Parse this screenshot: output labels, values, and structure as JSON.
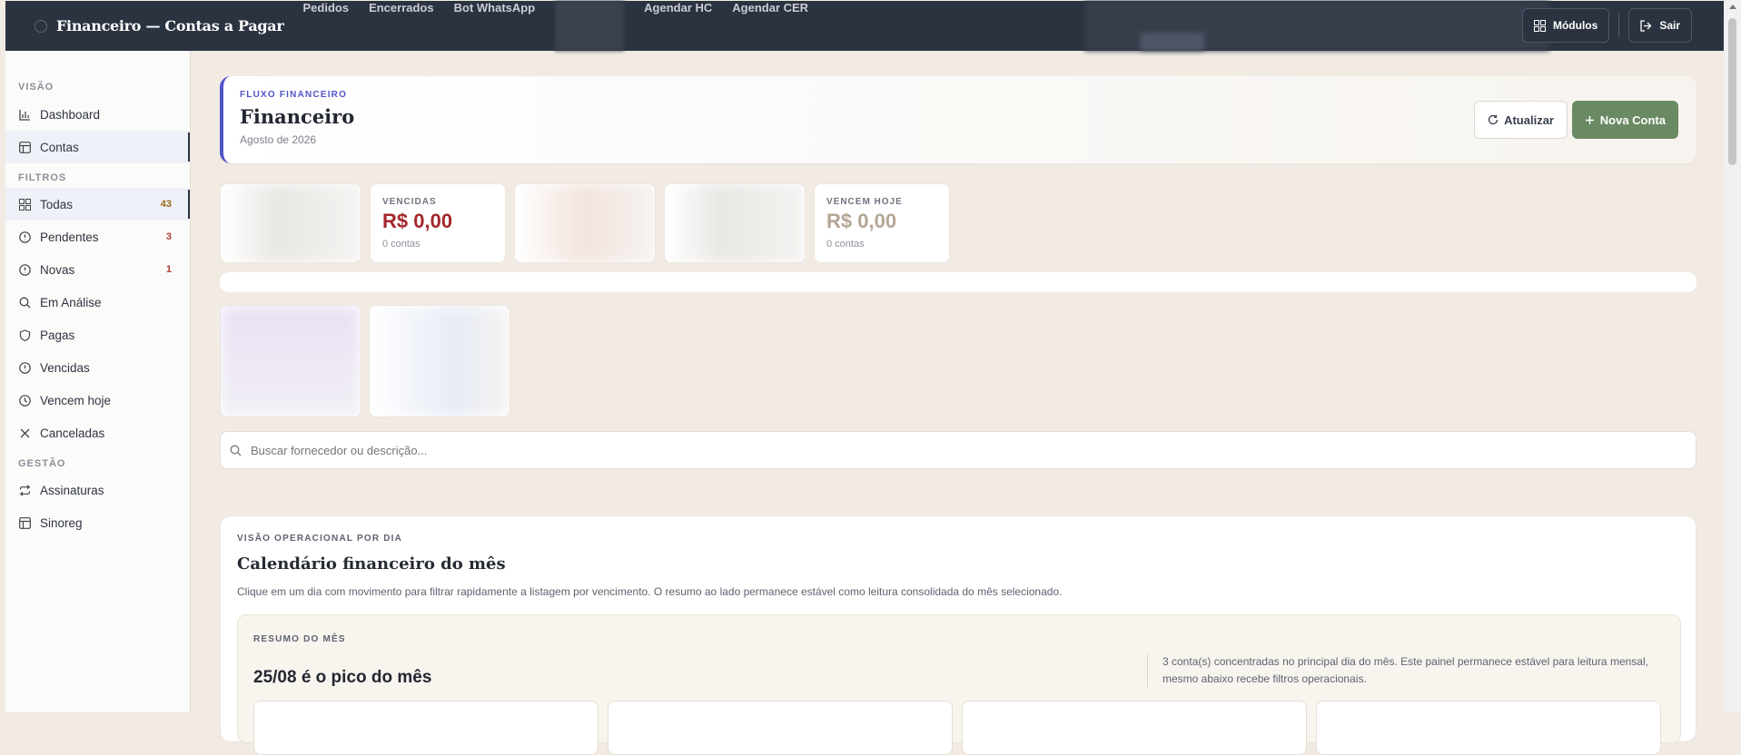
{
  "topbar": {
    "title": "Financeiro — Contas a Pagar",
    "nav": [
      "Pedidos",
      "Encerrados",
      "Bot WhatsApp",
      "",
      "Agendar HC",
      "Agendar CER"
    ],
    "modules_label": "Módulos",
    "logout_label": "Sair"
  },
  "sidebar": {
    "sections": {
      "visao": "VISÃO",
      "filtros": "FILTROS",
      "gestao": "GESTÃO"
    },
    "visao_items": [
      {
        "label": "Dashboard",
        "icon": "bar-chart-icon"
      },
      {
        "label": "Contas",
        "icon": "table-icon"
      }
    ],
    "filtro_items": [
      {
        "label": "Todas",
        "icon": "grid-icon",
        "badge": "43"
      },
      {
        "label": "Pendentes",
        "icon": "alert-circle-icon",
        "badge": "3"
      },
      {
        "label": "Novas",
        "icon": "alert-circle-icon",
        "badge": "1"
      },
      {
        "label": "Em Análise",
        "icon": "search-icon"
      },
      {
        "label": "Pagas",
        "icon": "shield-icon"
      },
      {
        "label": "Vencidas",
        "icon": "alert-circle-icon"
      },
      {
        "label": "Vencem hoje",
        "icon": "clock-icon"
      },
      {
        "label": "Canceladas",
        "icon": "close-icon"
      }
    ],
    "gestao_items": [
      {
        "label": "Assinaturas",
        "icon": "repeat-icon"
      },
      {
        "label": "Sinoreg",
        "icon": "table-icon"
      }
    ]
  },
  "hero": {
    "eyebrow": "FLUXO FINANCEIRO",
    "title": "Financeiro",
    "subtitle": "Agosto de 2026",
    "refresh_label": "Atualizar",
    "new_label": "Nova Conta"
  },
  "cards": {
    "vencidas": {
      "label": "VENCIDAS",
      "value": "R$ 0,00",
      "count": "0 contas",
      "color": "#a3272b"
    },
    "hoje": {
      "label": "VENCEM HOJE",
      "value": "R$ 0,00",
      "count": "0 contas",
      "color": "#b4a595"
    }
  },
  "search": {
    "placeholder": "Buscar fornecedor ou descrição..."
  },
  "calendar": {
    "eyebrow": "VISÃO OPERACIONAL POR DIA",
    "title": "Calendário financeiro do mês",
    "description": "Clique em um dia com movimento para filtrar rapidamente a listagem por vencimento. O resumo ao lado permanece estável como leitura consolidada do mês selecionado.",
    "summary": {
      "eyebrow": "RESUMO DO MÊS",
      "peak": "25/08 é o pico do mês",
      "note": "3 conta(s) concentradas no principal dia do mês. Este painel permanece estável para leitura mensal, mesmo abaixo recebe filtros operacionais."
    }
  }
}
